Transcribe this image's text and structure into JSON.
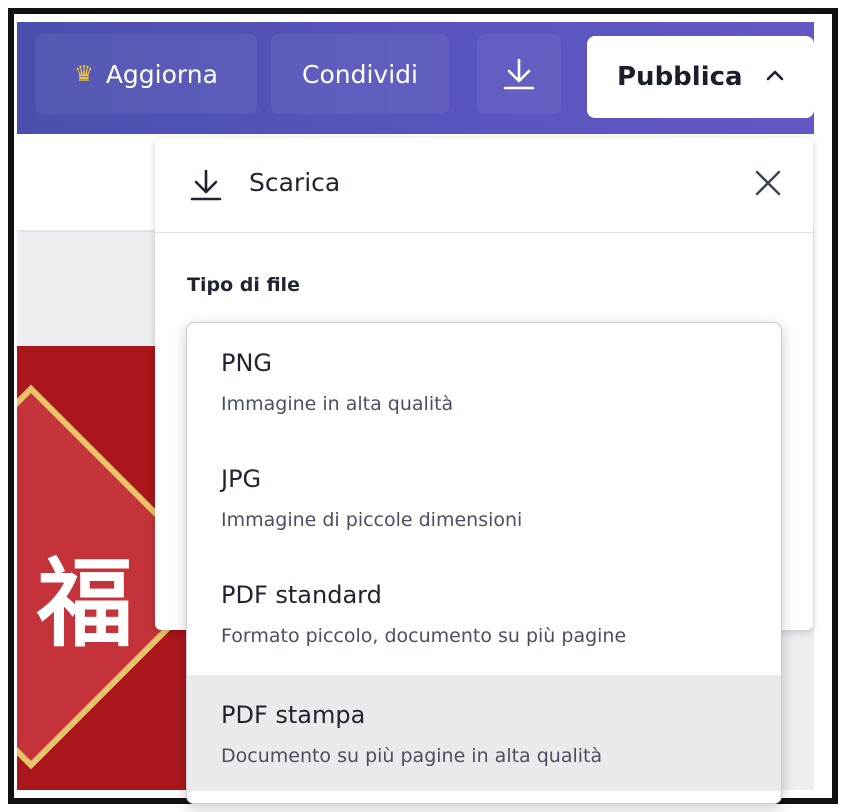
{
  "topbar": {
    "upgrade_label": "Aggiorna",
    "share_label": "Condividi",
    "publish_label": "Pubblica",
    "accent": "#5a55bf",
    "crown_color": "#f3c53c"
  },
  "download_panel": {
    "title": "Scarica",
    "file_type_label": "Tipo di file"
  },
  "file_types": [
    {
      "name": "PNG",
      "description": "Immagine in alta qualità"
    },
    {
      "name": "JPG",
      "description": "Immagine di piccole dimensioni"
    },
    {
      "name": "PDF standard",
      "description": "Formato piccolo, documento su più pagine"
    },
    {
      "name": "PDF stampa",
      "description": "Documento su più pagine in alta qualità"
    }
  ],
  "design": {
    "glyph": "福"
  }
}
